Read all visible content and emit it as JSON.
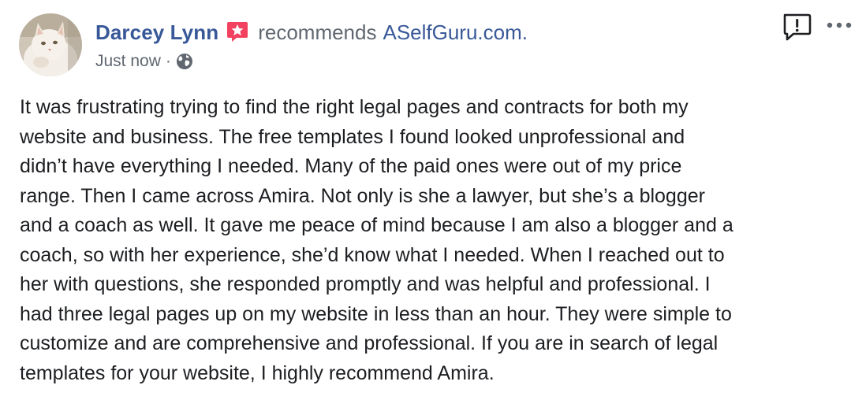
{
  "post": {
    "author": "Darcey Lynn",
    "action": "recommends",
    "page": "ASelfGuru.com.",
    "timestamp": "Just now",
    "separator": "·",
    "audience_icon": "globe-icon",
    "badge_icon": "recommendation-star-icon",
    "body_lines": [
      "It was frustrating trying to find the right legal pages and contracts for both my",
      "website and business. The free templates I found looked unprofessional and",
      "didn’t have everything I needed. Many of the paid ones were out of my price",
      "range. Then I came across Amira. Not only is she a lawyer, but she’s a blogger",
      "and a coach as well. It gave me peace of mind because I am also a blogger and a",
      "coach, so with her experience, she’d know what I needed. When I reached out to",
      "her with questions, she responded promptly and was helpful and professional. I",
      "had three legal pages up on my website in less than an hour. They were simple to",
      "customize and are comprehensive and professional. If you are in search of legal",
      "templates for your website, I highly recommend Amira."
    ]
  },
  "controls": {
    "report_icon": "report-flag-icon",
    "more_icon": "more-options-icon"
  },
  "colors": {
    "link_blue": "#385898",
    "muted_text": "#606770",
    "body_text": "#1c1e21",
    "badge_pink": "#f3425f"
  }
}
